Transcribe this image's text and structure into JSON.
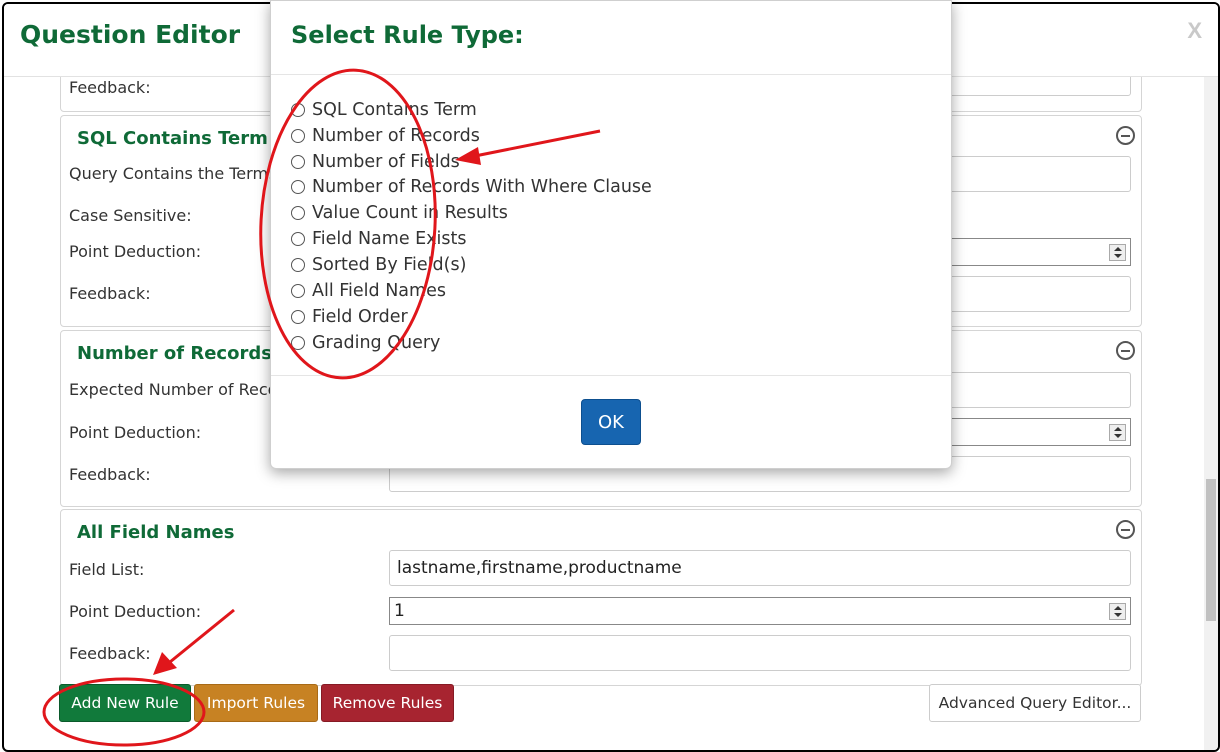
{
  "editor": {
    "title": "Question Editor",
    "close_label": "X"
  },
  "top_panel": {
    "feedback_label": "Feedback:"
  },
  "panels": [
    {
      "title": "SQL Contains Term",
      "fields": {
        "term_label": "Query Contains the Term:",
        "case_label": "Case Sensitive:",
        "deduction_label": "Point Deduction:",
        "feedback_label": "Feedback:"
      }
    },
    {
      "title": "Number of Records",
      "fields": {
        "expected_label": "Expected Number of Reco",
        "deduction_label": "Point Deduction:",
        "feedback_label": "Feedback:"
      }
    },
    {
      "title": "All Field Names",
      "fields": {
        "field_list_label": "Field List:",
        "field_list_value": "lastname,firstname,productname",
        "deduction_label": "Point Deduction:",
        "deduction_value": "1",
        "feedback_label": "Feedback:"
      }
    }
  ],
  "buttons": {
    "add": "Add New Rule",
    "import": "Import Rules",
    "remove": "Remove Rules",
    "advanced": "Advanced Query Editor..."
  },
  "modal": {
    "title": "Select Rule Type:",
    "options": [
      "SQL Contains Term",
      "Number of Records",
      "Number of Fields",
      "Number of Records With Where Clause",
      "Value Count in Results",
      "Field Name Exists",
      "Sorted By Field(s)",
      "All Field Names",
      "Field Order",
      "Grading Query"
    ],
    "ok_label": "OK"
  },
  "colors": {
    "heading_green": "#0f6a37",
    "add_button": "#117a3b",
    "import_button": "#c78223",
    "remove_button": "#a72430",
    "ok_button": "#1765b0",
    "annotation_red": "#e0161b"
  },
  "icons": {
    "panel_remove": "minus-circle-icon",
    "close": "close-icon"
  }
}
